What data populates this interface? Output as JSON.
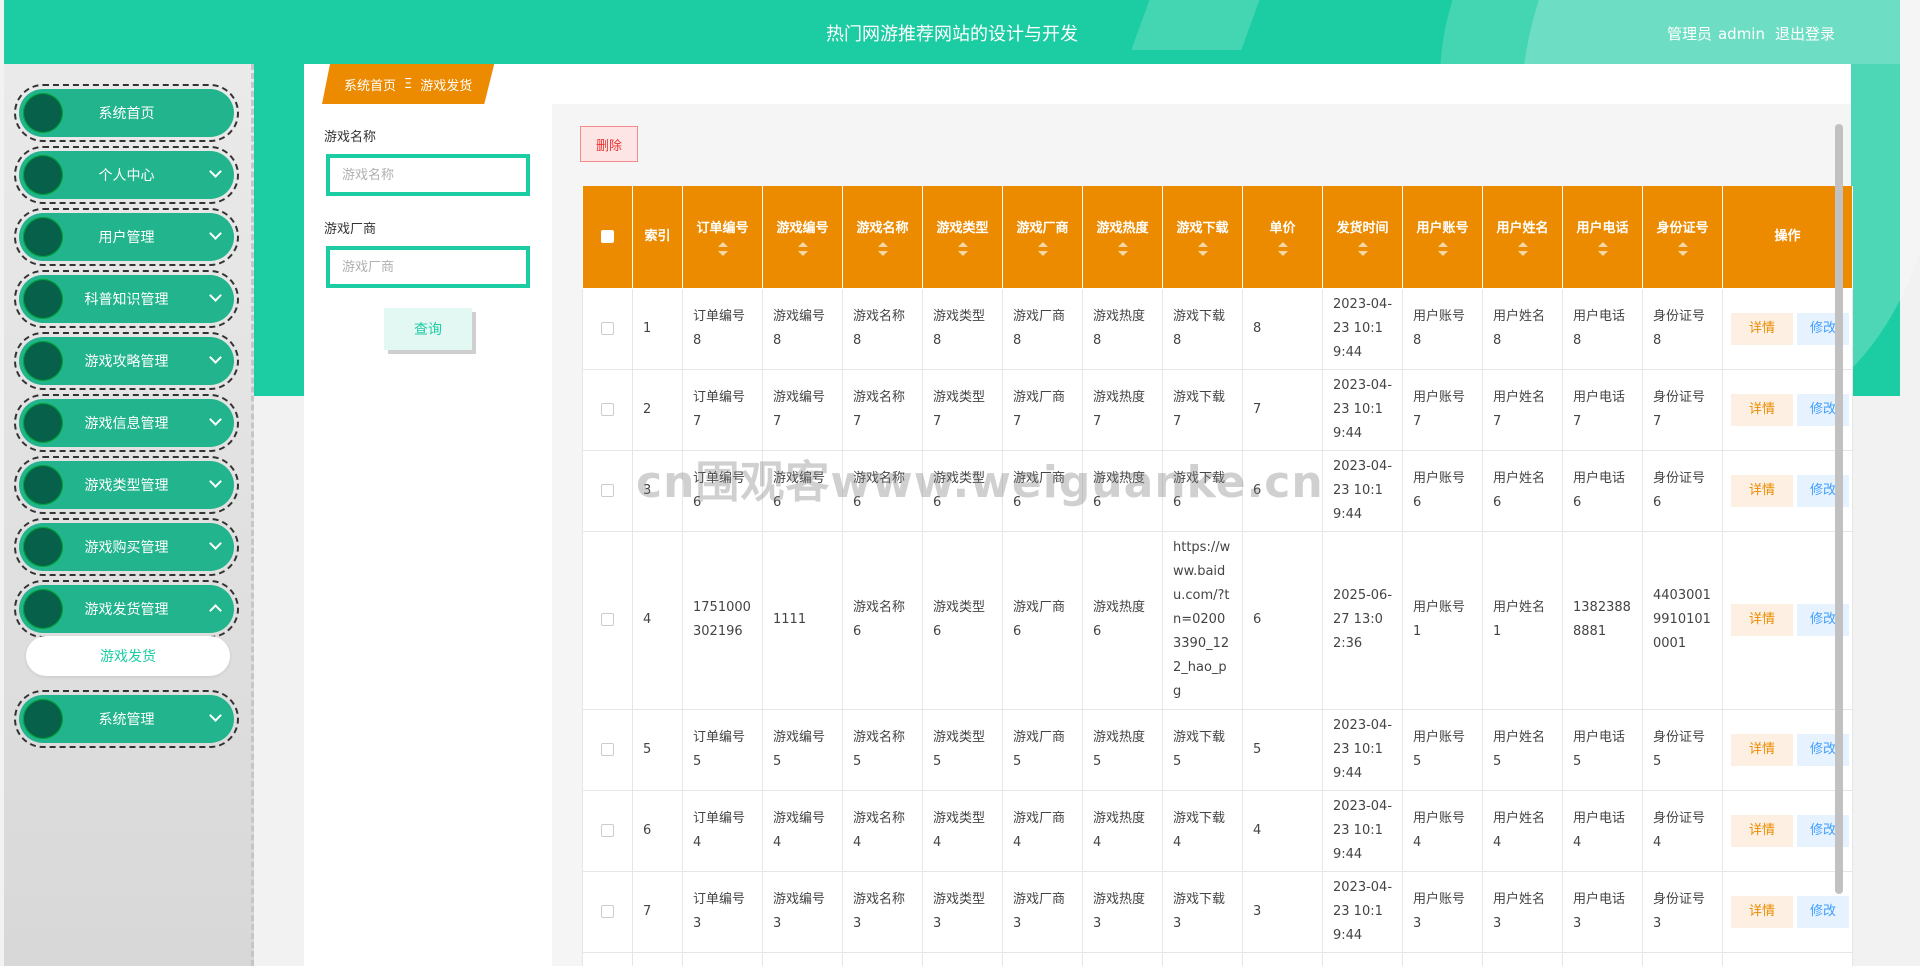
{
  "app": {
    "title": "热门网游推荐网站的设计与开发",
    "role": "管理员",
    "username": "admin",
    "logout": "退出登录"
  },
  "sidebar": {
    "items": [
      {
        "label": "系统首页",
        "has_arrow": false
      },
      {
        "label": "个人中心",
        "has_arrow": true
      },
      {
        "label": "用户管理",
        "has_arrow": true
      },
      {
        "label": "科普知识管理",
        "has_arrow": true
      },
      {
        "label": "游戏攻略管理",
        "has_arrow": true
      },
      {
        "label": "游戏信息管理",
        "has_arrow": true
      },
      {
        "label": "游戏类型管理",
        "has_arrow": true
      },
      {
        "label": "游戏购买管理",
        "has_arrow": true
      },
      {
        "label": "游戏发货管理",
        "has_arrow": true,
        "expanded": true
      },
      {
        "label": "系统管理",
        "has_arrow": true
      }
    ],
    "sub_item": "游戏发货"
  },
  "breadcrumb": {
    "home": "系统首页",
    "separator": "Ξ",
    "current": "游戏发货"
  },
  "filters": {
    "name_label": "游戏名称",
    "name_placeholder": "游戏名称",
    "vendor_label": "游戏厂商",
    "vendor_placeholder": "游戏厂商",
    "query": "查询"
  },
  "toolbar": {
    "delete": "删除"
  },
  "table": {
    "headers": [
      "索引",
      "订单编号",
      "游戏编号",
      "游戏名称",
      "游戏类型",
      "游戏厂商",
      "游戏热度",
      "游戏下载",
      "单价",
      "发货时间",
      "用户账号",
      "用户姓名",
      "用户电话",
      "身份证号",
      "操作"
    ],
    "detail_label": "详情",
    "edit_label": "修改",
    "rows": [
      [
        "1",
        "订单编号8",
        "游戏编号8",
        "游戏名称8",
        "游戏类型8",
        "游戏厂商8",
        "游戏热度8",
        "游戏下载8",
        "8",
        "2023-04-23 10:19:44",
        "用户账号8",
        "用户姓名8",
        "用户电话8",
        "身份证号8"
      ],
      [
        "2",
        "订单编号7",
        "游戏编号7",
        "游戏名称7",
        "游戏类型7",
        "游戏厂商7",
        "游戏热度7",
        "游戏下载7",
        "7",
        "2023-04-23 10:19:44",
        "用户账号7",
        "用户姓名7",
        "用户电话7",
        "身份证号7"
      ],
      [
        "3",
        "订单编号6",
        "游戏编号6",
        "游戏名称6",
        "游戏类型6",
        "游戏厂商6",
        "游戏热度6",
        "游戏下载6",
        "6",
        "2023-04-23 10:19:44",
        "用户账号6",
        "用户姓名6",
        "用户电话6",
        "身份证号6"
      ],
      [
        "4",
        "1751000302196",
        "1111",
        "游戏名称6",
        "游戏类型6",
        "游戏厂商6",
        "游戏热度6",
        "https://www.baidu.com/?tn=02003390_122_hao_pg",
        "6",
        "2025-06-27 13:02:36",
        "用户账号1",
        "用户姓名1",
        "13823888881",
        "440300199101010001"
      ],
      [
        "5",
        "订单编号5",
        "游戏编号5",
        "游戏名称5",
        "游戏类型5",
        "游戏厂商5",
        "游戏热度5",
        "游戏下载5",
        "5",
        "2023-04-23 10:19:44",
        "用户账号5",
        "用户姓名5",
        "用户电话5",
        "身份证号5"
      ],
      [
        "6",
        "订单编号4",
        "游戏编号4",
        "游戏名称4",
        "游戏类型4",
        "游戏厂商4",
        "游戏热度4",
        "游戏下载4",
        "4",
        "2023-04-23 10:19:44",
        "用户账号4",
        "用户姓名4",
        "用户电话4",
        "身份证号4"
      ],
      [
        "7",
        "订单编号3",
        "游戏编号3",
        "游戏名称3",
        "游戏类型3",
        "游戏厂商3",
        "游戏热度3",
        "游戏下载3",
        "3",
        "2023-04-23 10:19:44",
        "用户账号3",
        "用户姓名3",
        "用户电话3",
        "身份证号3"
      ]
    ]
  },
  "watermark": "cn围观客www.weiguanke.cn",
  "colors": {
    "primary": "#1ccca3",
    "accent": "#ed8b00",
    "menu": "#21b48d"
  }
}
